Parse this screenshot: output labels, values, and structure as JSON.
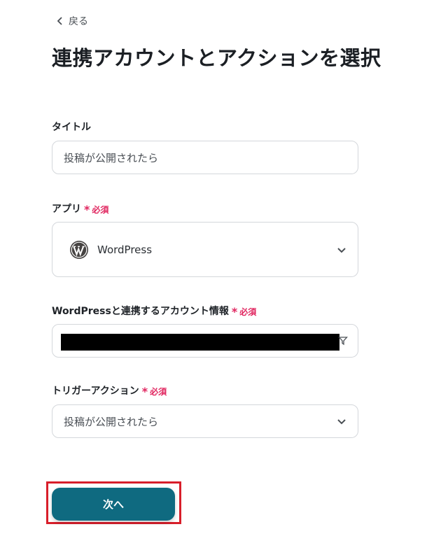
{
  "nav": {
    "back_label": "戻る"
  },
  "page": {
    "title": "連携アカウントとアクションを選択"
  },
  "fields": {
    "title": {
      "label": "タイトル",
      "value": "投稿が公開されたら"
    },
    "app": {
      "label": "アプリ",
      "required": "必須",
      "value": "WordPress",
      "icon": "wordpress-logo"
    },
    "account": {
      "label": "WordPressと連携するアカウント情報",
      "required": "必須"
    },
    "trigger": {
      "label": "トリガーアクション",
      "required": "必須",
      "value": "投稿が公開されたら"
    }
  },
  "actions": {
    "next_label": "次へ"
  },
  "colors": {
    "primary": "#0f6a80",
    "required": "#e0245e",
    "highlight": "#d81e2a"
  }
}
